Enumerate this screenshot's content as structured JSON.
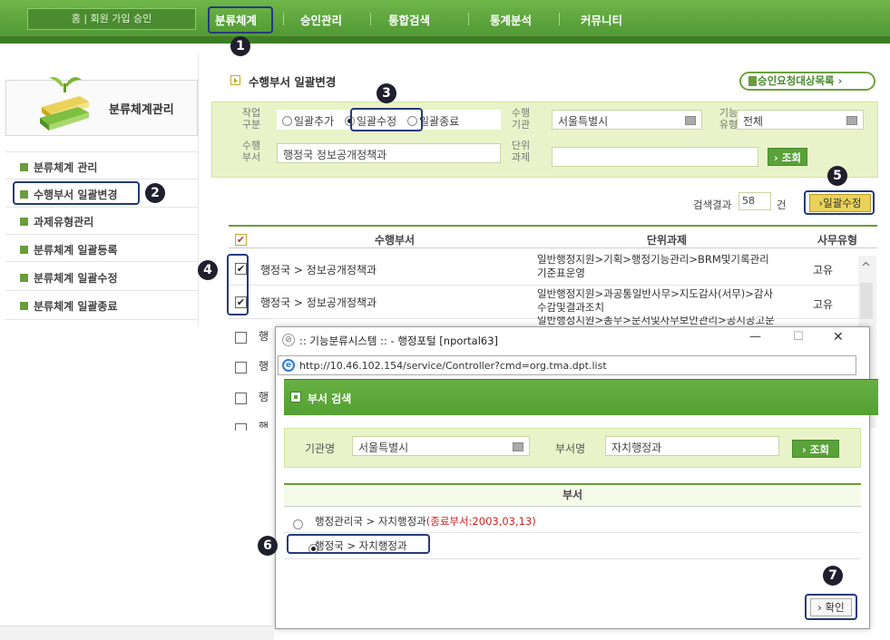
{
  "topnav": {
    "home_links": "홈 | 회원 가입 승인",
    "items": [
      "분류체계",
      "승인관리",
      "통합검색",
      "통계분석",
      "커뮤니티"
    ]
  },
  "callouts": [
    "1",
    "2",
    "3",
    "4",
    "5",
    "6",
    "7"
  ],
  "sidebar": {
    "title": "분류체계관리",
    "items": [
      "분류체계 관리",
      "수행부서 일괄변경",
      "과제유형관리",
      "분류체계 일괄등록",
      "분류체계 일괄수정",
      "분류체계 일괄종료"
    ]
  },
  "page": {
    "title": "수행부서 일괄변경",
    "approval_list_label": "승인요청대상목록"
  },
  "search": {
    "work_type_label": "작업\n구분",
    "options": [
      "일괄추가",
      "일괄수정",
      "일괄종료"
    ],
    "selected_option": "일괄수정",
    "agency_label": "수행\n기관",
    "agency_value": "서울특별시",
    "function_label": "기능\n유형",
    "function_value": "전체",
    "dept_label": "수행\n부서",
    "dept_value": "행정국 정보공개정책과",
    "task_label": "단위\n과제",
    "task_value": "",
    "search_button": "조회"
  },
  "results": {
    "count_label": "검색결과",
    "count": "58",
    "count_unit": "건",
    "bulk_edit_button": "일괄수정"
  },
  "table": {
    "headers": [
      "수행부서",
      "단위과제",
      "사무유형"
    ],
    "rows": [
      {
        "checked": true,
        "dept": "행정국 > 정보공개정책과",
        "task_line1": "일반행정지원>기획>행정기능관리>BRM및기록관리",
        "task_line2": "기준표운영",
        "type": "고유"
      },
      {
        "checked": true,
        "dept": "행정국 > 정보공개정책과",
        "task_line1": "일반행정지원>과공통일반사무>지도감사(서무)>감사",
        "task_line2": "수감및결과조치",
        "type": "고유"
      },
      {
        "checked": false,
        "dept": "행",
        "task_line1": "일반행정지원>총무>문서및사무보안관리>공시공고문",
        "task_line2": "",
        "type": ""
      },
      {
        "checked": false,
        "dept": "행",
        "task_line1": "",
        "task_line2": "",
        "type": ""
      },
      {
        "checked": false,
        "dept": "행",
        "task_line1": "",
        "task_line2": "",
        "type": ""
      },
      {
        "checked": false,
        "dept": "행",
        "task_line1": "",
        "task_line2": "",
        "type": ""
      }
    ]
  },
  "popup": {
    "window_title": ":: 기능분류시스템 :: - 행정포털 [nportal63]",
    "url": "http://10.46.102.154/service/Controller?cmd=org.tma.dpt.list",
    "header": "부서 검색",
    "org_label": "기관명",
    "org_value": "서울특별시",
    "dept_label": "부서명",
    "dept_value": "자치행정과",
    "search_button": "조회",
    "column": "부서",
    "rows": [
      {
        "text": "행정관리국 > 자치행정과",
        "note": "(종료부서:2003,03,13)",
        "selected": false
      },
      {
        "text": "행정국 > 자치행정과",
        "note": "",
        "selected": true
      }
    ],
    "confirm_button": "확인",
    "controls": {
      "minimize": "—",
      "maximize": "☐",
      "close": "✕"
    }
  },
  "colors": {
    "nav_green": "#5aa23a",
    "panel_bg": "#e9f3c9",
    "callout_border": "#243a7a",
    "end_note": "#d42020"
  }
}
